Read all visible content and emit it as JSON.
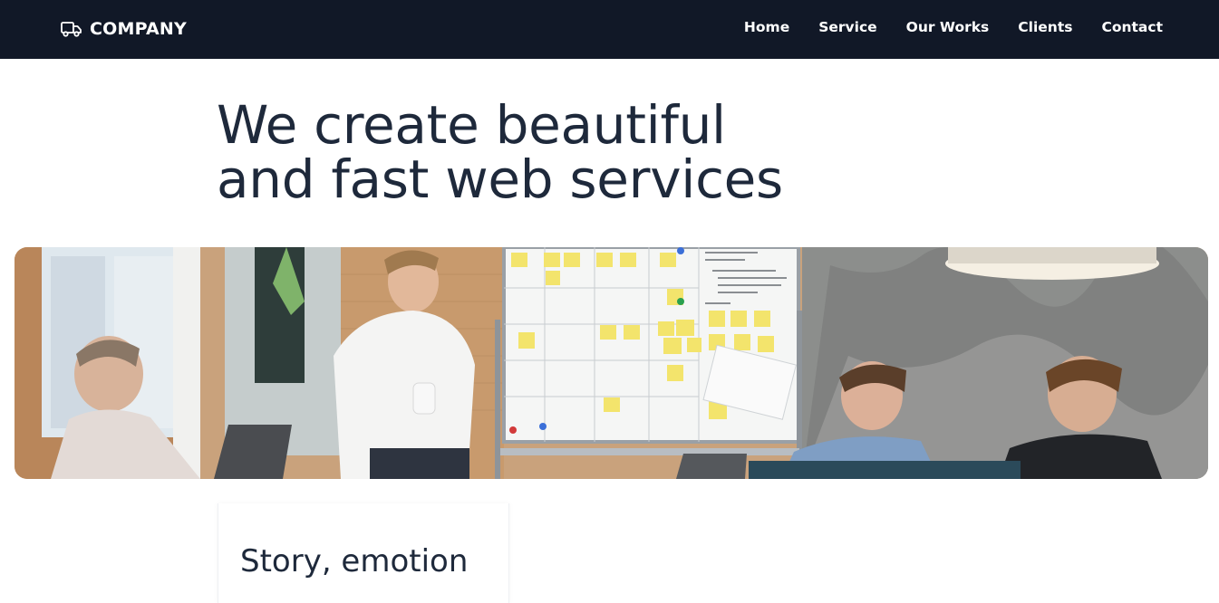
{
  "brand": {
    "name": "COMPANY",
    "icon": "truck-icon"
  },
  "nav": {
    "items": [
      {
        "label": "Home"
      },
      {
        "label": "Service"
      },
      {
        "label": "Our Works"
      },
      {
        "label": "Clients"
      },
      {
        "label": "Contact"
      }
    ]
  },
  "hero": {
    "title_line1": "We create beautiful",
    "title_line2": "and fast web services"
  },
  "feature_card": {
    "title": "Story, emotion"
  },
  "colors": {
    "navbar_bg": "#111827",
    "heading": "#1e293b"
  }
}
